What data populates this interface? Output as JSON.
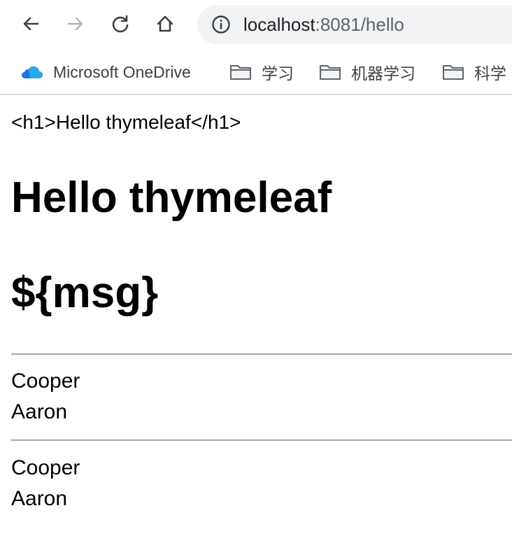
{
  "browser": {
    "url_host": "localhost",
    "url_rest": ":8081/hello",
    "icons": {
      "back": "arrow-left-icon",
      "forward": "arrow-right-icon",
      "reload": "reload-icon",
      "home": "home-icon",
      "info": "info-icon"
    }
  },
  "bookmarks": [
    {
      "label": "Microsoft OneDrive",
      "icon": "cloud-icon"
    },
    {
      "label": "学习",
      "icon": "folder-icon"
    },
    {
      "label": "机器学习",
      "icon": "folder-icon"
    },
    {
      "label": "科学",
      "icon": "folder-icon"
    }
  ],
  "page": {
    "escaped_text": "<h1>Hello thymeleaf</h1>",
    "heading": "Hello thymeleaf",
    "unprocessed_expression": "${msg}",
    "list1": [
      "Cooper",
      "Aaron"
    ],
    "list2": [
      "Cooper",
      "Aaron"
    ]
  },
  "colors": {
    "omnibox_bg": "#f1f3f4",
    "onedrive_blue": "#1a73e8",
    "divider": "#a9a9a9"
  }
}
